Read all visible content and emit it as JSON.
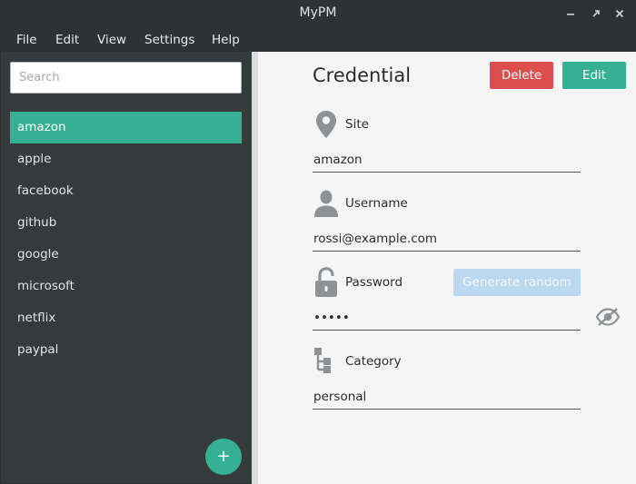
{
  "window": {
    "title": "MyPM"
  },
  "menu": [
    "File",
    "Edit",
    "View",
    "Settings",
    "Help"
  ],
  "sidebar": {
    "search_placeholder": "Search",
    "items": [
      "amazon",
      "apple",
      "facebook",
      "github",
      "google",
      "microsoft",
      "netflix",
      "paypal"
    ],
    "selected_index": 0,
    "add_label": "+"
  },
  "main": {
    "title": "Credential",
    "delete_label": "Delete",
    "edit_label": "Edit",
    "site_label": "Site",
    "site_value": "amazon",
    "username_label": "Username",
    "username_value": "rossi@example.com",
    "password_label": "Password",
    "password_value": "•••••",
    "generate_label": "Generate random",
    "category_label": "Category",
    "category_value": "personal"
  },
  "colors": {
    "accent": "#36b092",
    "danger": "#db4f4f",
    "sidebar_bg": "#353a3c",
    "generate_disabled": "#bcd8f0"
  }
}
